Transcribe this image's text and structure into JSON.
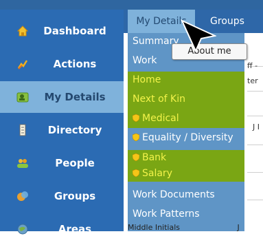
{
  "sidebar": {
    "items": [
      {
        "label": "Dashboard",
        "icon": "home-icon"
      },
      {
        "label": "Actions",
        "icon": "actions-icon"
      },
      {
        "label": "My Details",
        "icon": "my-details-icon",
        "active": true
      },
      {
        "label": "Directory",
        "icon": "directory-icon"
      },
      {
        "label": "People",
        "icon": "people-icon"
      },
      {
        "label": "Groups",
        "icon": "groups-icon"
      },
      {
        "label": "Areas",
        "icon": "areas-icon"
      }
    ]
  },
  "tabs": [
    {
      "label": "My Details",
      "active": true
    },
    {
      "label": "Groups"
    }
  ],
  "dropdown": {
    "items": [
      {
        "label": "Summary",
        "highlight": false
      },
      {
        "label": "Work",
        "highlight": false
      },
      {
        "label": "Home",
        "highlight": true,
        "color": "yellow"
      },
      {
        "label": "Next of Kin",
        "highlight": true,
        "color": "yellow"
      },
      {
        "label": "Medical",
        "highlight": true,
        "color": "yellow",
        "shield": true
      },
      {
        "label": "Equality / Diversity",
        "highlight": false,
        "shield": true
      },
      {
        "label": "Bank",
        "highlight": true,
        "color": "yellow",
        "shield": true
      },
      {
        "label": "Salary",
        "highlight": true,
        "color": "yellow",
        "shield": true
      },
      {
        "label": "Work Documents",
        "highlight": false
      },
      {
        "label": "Work Patterns",
        "highlight": false
      }
    ]
  },
  "tooltip": {
    "text": "About me"
  },
  "background": {
    "frag1": "ff -",
    "frag2": "ter",
    "frag3": "J I",
    "middle_label": "Middle Initials",
    "middle_value": "J"
  },
  "colors": {
    "sidebar": "#2b6bb3",
    "sidebar_active": "#7fb2db",
    "dropdown": "#5f95c6",
    "highlight": "#7aa614",
    "highlight_text": "#f3f34a"
  }
}
